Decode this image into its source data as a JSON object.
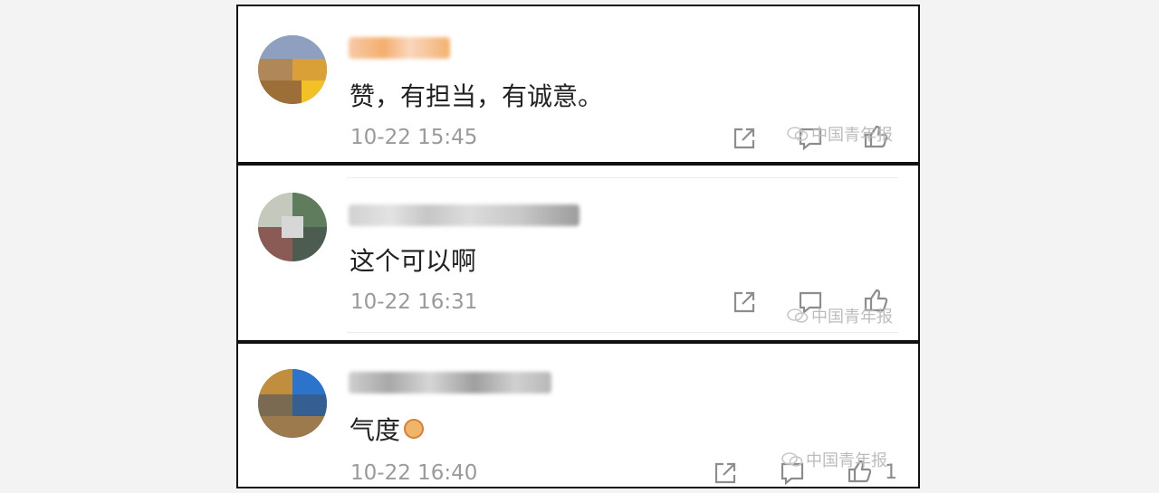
{
  "comments": [
    {
      "text": "赞，有担当，有诚意。",
      "time": "10-22 15:45",
      "like_count": ""
    },
    {
      "text": "这个可以啊",
      "time": "10-22 16:31",
      "like_count": ""
    },
    {
      "text": "气度",
      "time": "10-22 16:40",
      "like_count": "1"
    }
  ],
  "watermark": {
    "text": "中国青年报"
  },
  "icons": {
    "share": "share-icon",
    "comment": "comment-icon",
    "like": "thumbs-up-icon",
    "watermark_logo": "wechat-icon",
    "emoji": "fist-emoji-icon"
  },
  "colors": {
    "frame": "#111111",
    "time": "#9a9a9a",
    "text": "#222222",
    "watermark": "#bcbcbc"
  }
}
